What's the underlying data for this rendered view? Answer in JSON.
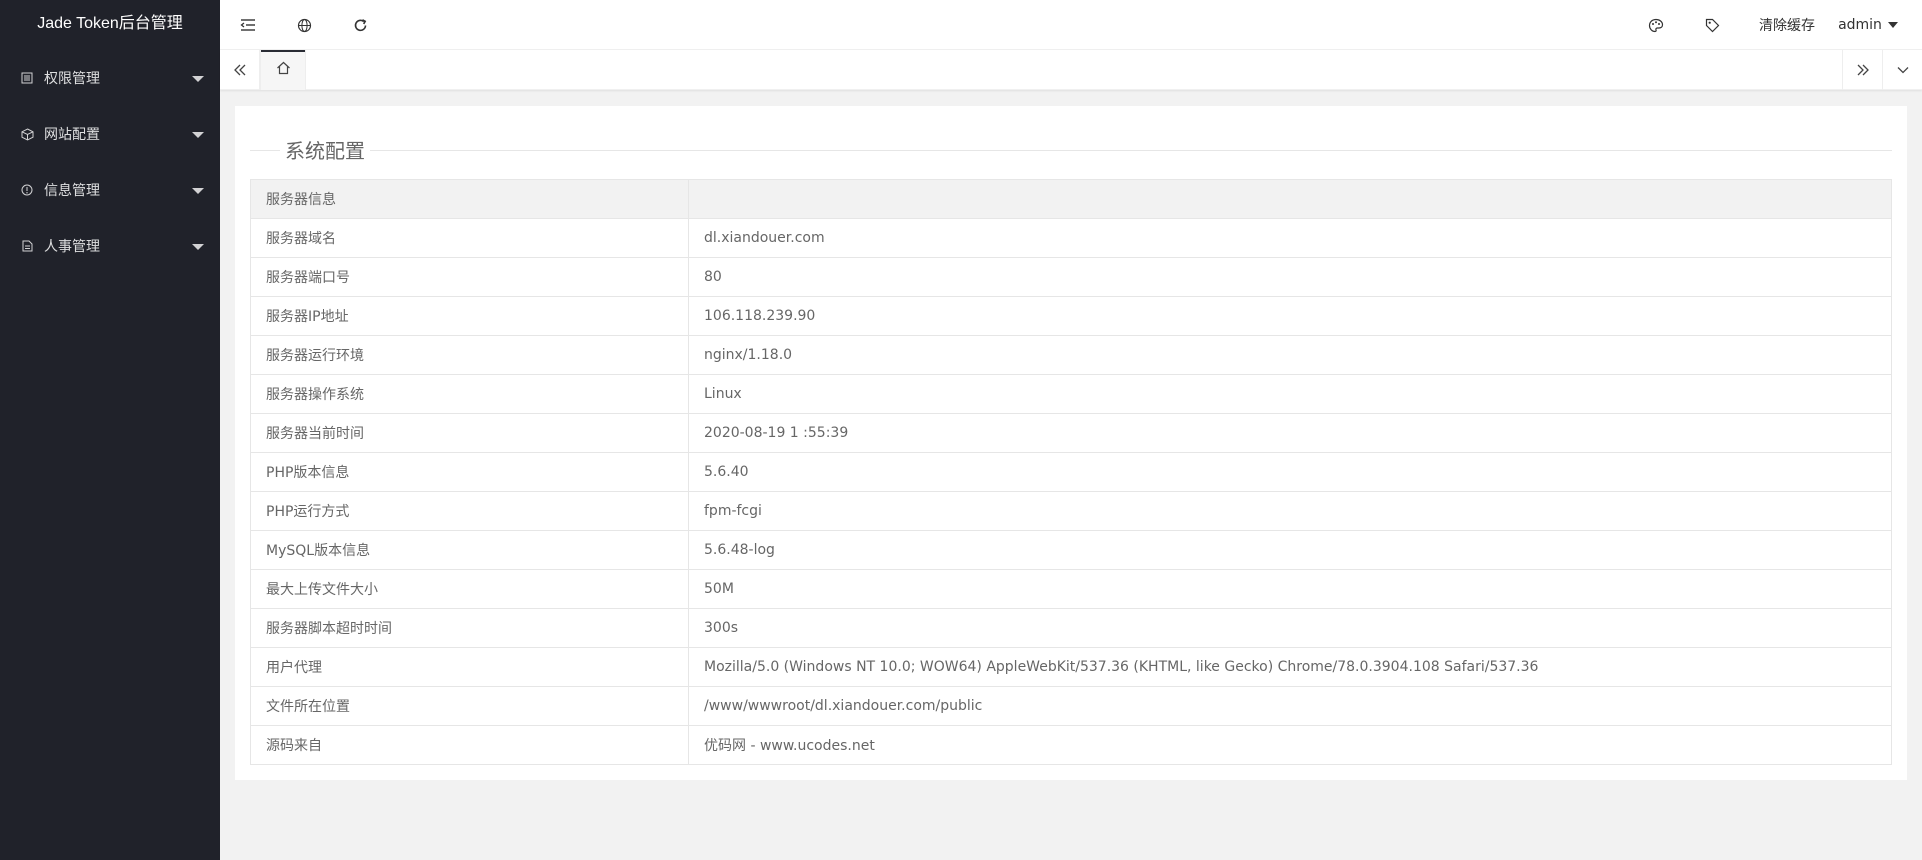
{
  "app": {
    "title": "Jade Token后台管理"
  },
  "sidebar": {
    "items": [
      {
        "label": "权限管理",
        "icon": "list-icon"
      },
      {
        "label": "网站配置",
        "icon": "cube-icon"
      },
      {
        "label": "信息管理",
        "icon": "info-icon"
      },
      {
        "label": "人事管理",
        "icon": "document-icon"
      }
    ]
  },
  "header": {
    "icons": [
      "menu-fold-icon",
      "globe-icon",
      "refresh-icon"
    ],
    "right": {
      "theme_icon": "palette-icon",
      "tag_icon": "tag-icon",
      "clear_cache_label": "清除缓存",
      "user_label": "admin"
    }
  },
  "tabs": {
    "home_icon": "home-icon"
  },
  "main": {
    "legend": "系统配置",
    "table_header": "服务器信息",
    "rows": [
      {
        "label": "服务器域名",
        "value": "dl.xiandouer.com"
      },
      {
        "label": "服务器端口号",
        "value": "80"
      },
      {
        "label": "服务器IP地址",
        "value": "106.118.239.90"
      },
      {
        "label": "服务器运行环境",
        "value": "nginx/1.18.0"
      },
      {
        "label": "服务器操作系统",
        "value": "Linux"
      },
      {
        "label": "服务器当前时间",
        "value": "2020-08-19 1 :55:39"
      },
      {
        "label": "PHP版本信息",
        "value": "5.6.40"
      },
      {
        "label": "PHP运行方式",
        "value": "fpm-fcgi"
      },
      {
        "label": "MySQL版本信息",
        "value": "5.6.48-log"
      },
      {
        "label": "最大上传文件大小",
        "value": "50M"
      },
      {
        "label": "服务器脚本超时时间",
        "value": "300s"
      },
      {
        "label": "用户代理",
        "value": "Mozilla/5.0 (Windows NT 10.0; WOW64) AppleWebKit/537.36 (KHTML, like Gecko) Chrome/78.0.3904.108 Safari/537.36"
      },
      {
        "label": "文件所在位置",
        "value": "/www/wwwroot/dl.xiandouer.com/public"
      },
      {
        "label": "源码来自",
        "value": "优码网 - www.ucodes.net"
      }
    ]
  },
  "colors": {
    "sidebar_bg": "#20222a",
    "page_bg": "#f2f2f2",
    "border": "#e6e6e6"
  }
}
